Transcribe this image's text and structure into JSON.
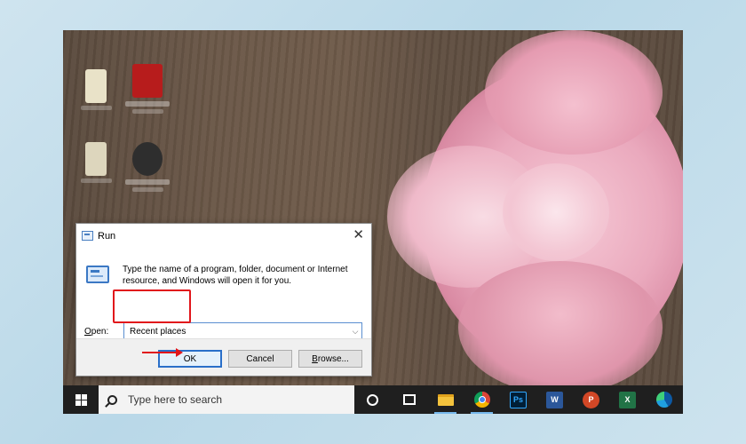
{
  "run_dialog": {
    "title": "Run",
    "description": "Type the name of a program, folder, document or Internet resource, and Windows will open it for you.",
    "open_label_prefix": "",
    "open_label_underlined": "O",
    "open_label_rest": "pen:",
    "open_value": "Recent places",
    "buttons": {
      "ok": "OK",
      "cancel": "Cancel",
      "browse_underlined": "B",
      "browse_rest": "rowse..."
    }
  },
  "taskbar": {
    "search_placeholder": "Type here to search",
    "pinned_apps": [
      "cortana",
      "task-view",
      "file-explorer",
      "chrome",
      "photoshop",
      "word",
      "powerpoint",
      "excel",
      "edge"
    ],
    "app_letters": {
      "photoshop": "Ps",
      "word": "W",
      "powerpoint": "P",
      "excel": "X"
    }
  },
  "colors": {
    "highlight": "#e1161b",
    "taskbar": "#1f1f1f",
    "ok_border": "#2a6fc9"
  }
}
